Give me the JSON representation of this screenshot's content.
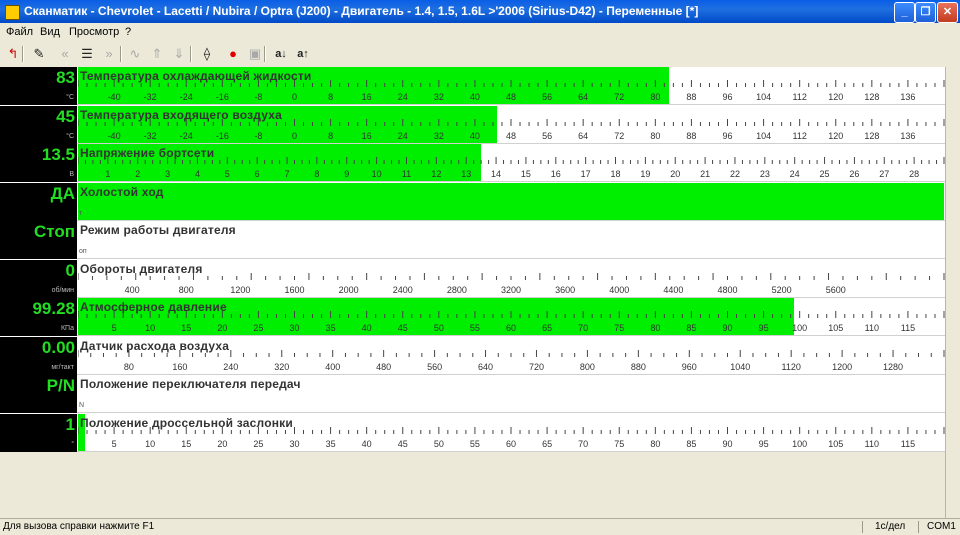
{
  "window": {
    "title": "Сканматик - Chevrolet - Lacetti / Nubira / Optra (J200) - Двигатель - 1.4, 1.5, 1.6L >'2006 (Sirius-D42) - Переменные [*]",
    "minimize": "_",
    "maximize": "❐",
    "close": "✕"
  },
  "menu": [
    "Файл",
    "Вид",
    "Просмотр",
    "?"
  ],
  "toolbar": [
    {
      "name": "back-arrow-icon",
      "glyph": "↰",
      "disabled": false
    },
    {
      "name": "edit-icon",
      "glyph": "✎",
      "disabled": false
    },
    {
      "name": "rewind-icon",
      "glyph": "«",
      "disabled": true
    },
    {
      "name": "list-icon",
      "glyph": "☰",
      "disabled": false
    },
    {
      "name": "forward-icon",
      "glyph": "»",
      "disabled": true
    },
    {
      "name": "wave-icon",
      "glyph": "∿",
      "disabled": true
    },
    {
      "name": "upload-icon",
      "glyph": "⇑",
      "disabled": true
    },
    {
      "name": "download-icon",
      "glyph": "⇓",
      "disabled": true
    },
    {
      "name": "connect-icon",
      "glyph": "⟠",
      "disabled": false
    },
    {
      "name": "record-icon",
      "glyph": "●",
      "disabled": false
    },
    {
      "name": "save-icon",
      "glyph": "▣",
      "disabled": true
    },
    {
      "name": "font-decrease-icon",
      "glyph": "a↓",
      "disabled": false
    },
    {
      "name": "font-increase-icon",
      "glyph": "a↑",
      "disabled": false
    }
  ],
  "colors": {
    "bar": "#00ee00",
    "value": "#22dd22",
    "record": "#e00000"
  },
  "parameters": [
    {
      "name": "Температура охлаждающей жидкости",
      "value": "83",
      "unit": "°C",
      "scale_min": -48,
      "scale_max": 144,
      "current": 83,
      "labels": [
        -40,
        -32,
        -24,
        -16,
        -8,
        0,
        8,
        16,
        24,
        32,
        40,
        48,
        56,
        64,
        72,
        80,
        88,
        96,
        104,
        112,
        120,
        128,
        136
      ]
    },
    {
      "name": "Температура входящего воздуха",
      "value": "45",
      "unit": "°C",
      "scale_min": -48,
      "scale_max": 144,
      "current": 45,
      "labels": [
        -40,
        -32,
        -24,
        -16,
        -8,
        0,
        8,
        16,
        24,
        32,
        40,
        48,
        56,
        64,
        72,
        80,
        88,
        96,
        104,
        112,
        120,
        128,
        136
      ]
    },
    {
      "name": "Напряжение бортсети",
      "value": "13.5",
      "unit": "В",
      "scale_min": 0,
      "scale_max": 29,
      "current": 13.5,
      "labels": [
        1,
        2,
        3,
        4,
        5,
        6,
        7,
        8,
        9,
        10,
        11,
        12,
        13,
        14,
        15,
        16,
        17,
        18,
        19,
        20,
        21,
        22,
        23,
        24,
        25,
        26,
        27,
        28
      ]
    },
    {
      "name": "Холостой ход",
      "value": "ДА",
      "unit": "",
      "small": "т",
      "current_fraction": 1.0,
      "labels": []
    },
    {
      "name": "Режим работы двигателя",
      "value": "Стоп",
      "unit": "",
      "small": "оп",
      "current_fraction": 0,
      "labels": []
    },
    {
      "name": "Обороты двигателя",
      "value": "0",
      "unit": "об/мин",
      "scale_min": 0,
      "scale_max": 6400,
      "current": 0,
      "labels": [
        400,
        800,
        1200,
        1600,
        2000,
        2400,
        2800,
        3200,
        3600,
        4000,
        4400,
        4800,
        5200,
        5600
      ]
    },
    {
      "name": "Атмосферное давление",
      "value": "99.28",
      "unit": "КПа",
      "scale_min": 0,
      "scale_max": 120,
      "current": 99.28,
      "labels": [
        5,
        10,
        15,
        20,
        25,
        30,
        35,
        40,
        45,
        50,
        55,
        60,
        65,
        70,
        75,
        80,
        85,
        90,
        95,
        100,
        105,
        110,
        115
      ]
    },
    {
      "name": "Датчик расхода воздуха",
      "value": "0.00",
      "unit": "мг/такт",
      "scale_min": 0,
      "scale_max": 1360,
      "current": 0,
      "labels": [
        80,
        160,
        240,
        320,
        400,
        480,
        560,
        640,
        720,
        800,
        880,
        960,
        1040,
        1120,
        1200,
        1280
      ]
    },
    {
      "name": "Положение переключателя передач",
      "value": "P/N",
      "unit": "",
      "small": "N",
      "current_fraction": 0,
      "labels": []
    },
    {
      "name": "Положение дроссельной заслонки",
      "value": "1",
      "unit": "°",
      "scale_min": 0,
      "scale_max": 120,
      "current": 1,
      "labels": [
        5,
        10,
        15,
        20,
        25,
        30,
        35,
        40,
        45,
        50,
        55,
        60,
        65,
        70,
        75,
        80,
        85,
        90,
        95,
        100,
        105,
        110,
        115
      ]
    }
  ],
  "status": {
    "hint": "Для вызова справки нажмите F1",
    "rate": "1с/дел",
    "port": "COM1"
  }
}
